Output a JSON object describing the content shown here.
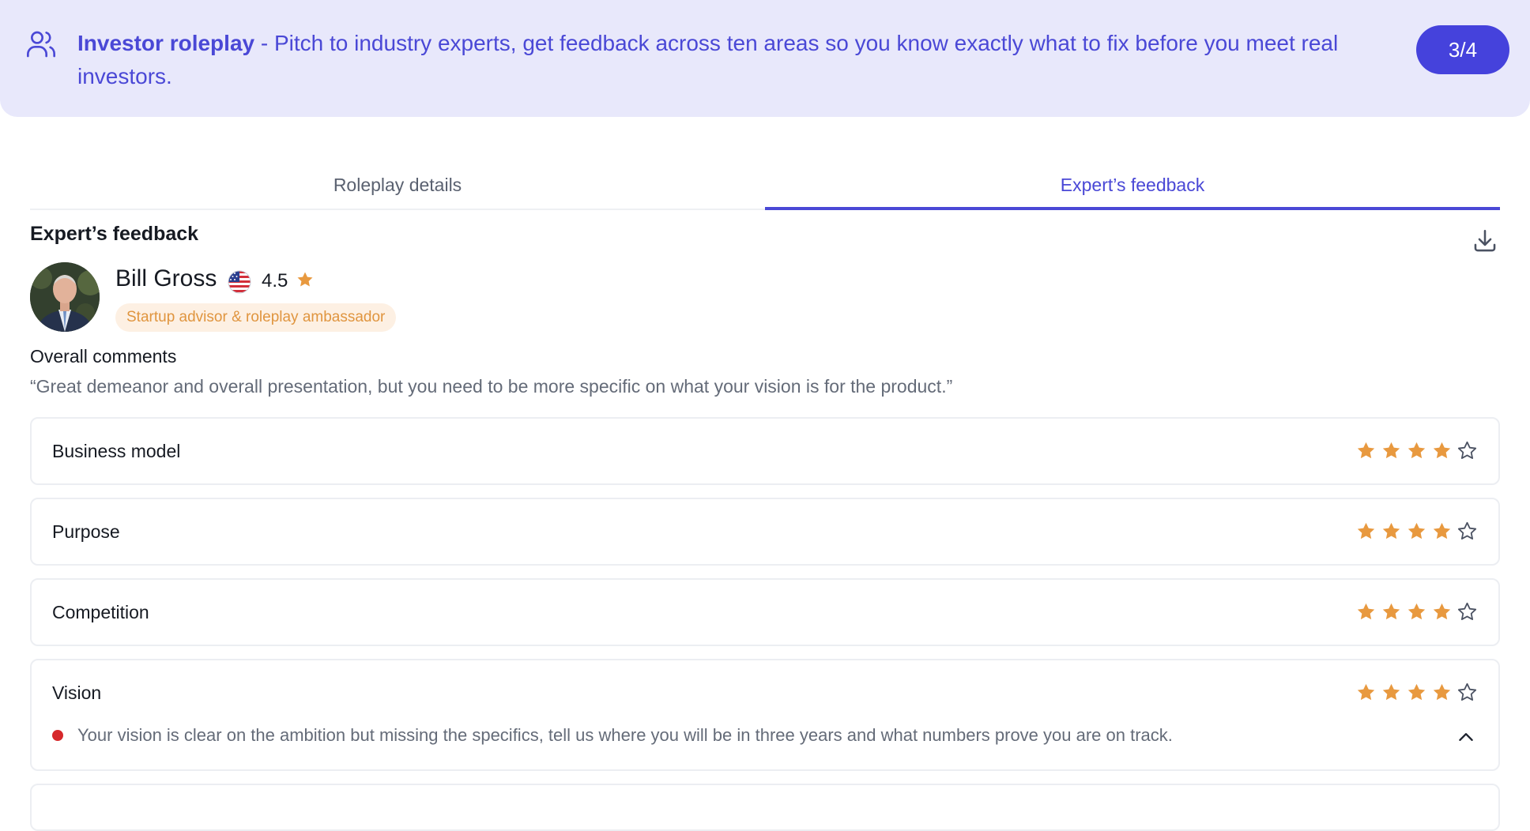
{
  "banner": {
    "title": "Investor roleplay",
    "separator": " - ",
    "description": "Pitch to industry experts, get feedback across ten areas so you know exactly what to fix before you meet real investors.",
    "step": "3/4",
    "icon": "users-icon"
  },
  "tabs": [
    {
      "label": "Roleplay details",
      "active": false
    },
    {
      "label": "Expert’s feedback",
      "active": true
    }
  ],
  "feedback": {
    "title": "Expert’s feedback",
    "download_icon": "download-icon",
    "expert": {
      "name": "Bill Gross",
      "flag": "us-flag-icon",
      "rating": "4.5",
      "role": "Startup advisor & roleplay ambassador"
    },
    "overall_label": "Overall comments",
    "overall_text": "“Great demeanor and overall presentation, but you need to be more specific on what your vision is for the product.”",
    "areas": [
      {
        "label": "Business model",
        "stars": 4,
        "max": 5
      },
      {
        "label": "Purpose",
        "stars": 4,
        "max": 5
      },
      {
        "label": "Competition",
        "stars": 4,
        "max": 5
      },
      {
        "label": "Vision",
        "stars": 4,
        "max": 5,
        "note": "Your vision is clear on the ambition but missing the specifics, tell us where you will be in three years and what numbers prove you are on track.",
        "expanded": true
      }
    ]
  },
  "colors": {
    "accent": "#4a48d6",
    "banner_bg": "#e8e8fb",
    "star": "#e8993f",
    "badge_bg": "#fdf0e3",
    "alert": "#d6282b"
  }
}
